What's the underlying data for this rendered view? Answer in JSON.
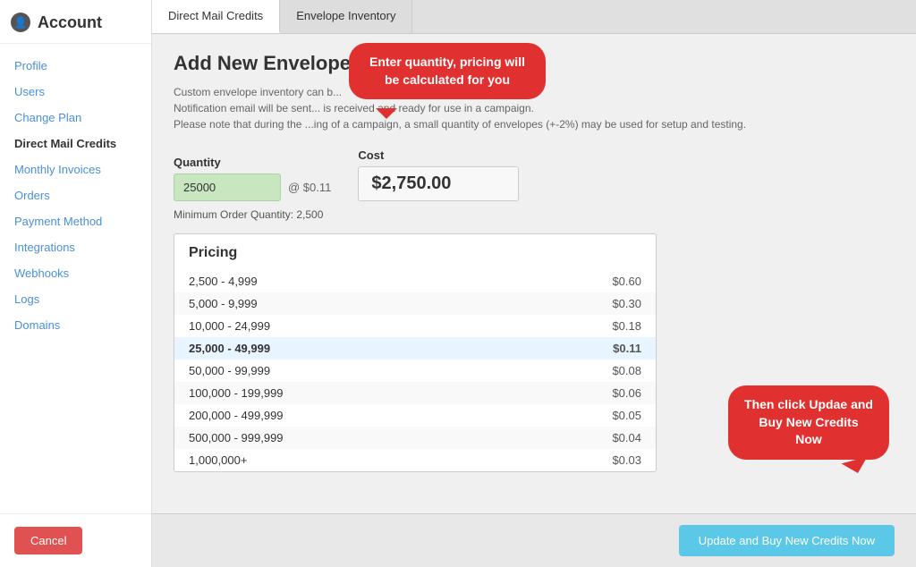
{
  "sidebar": {
    "header": {
      "icon": "👤",
      "title": "Account"
    },
    "nav_items": [
      {
        "label": "Profile",
        "href": "#",
        "active": false
      },
      {
        "label": "Users",
        "href": "#",
        "active": false
      },
      {
        "label": "Change Plan",
        "href": "#",
        "active": false
      },
      {
        "label": "Direct Mail Credits",
        "href": "#",
        "active": true
      },
      {
        "label": "Monthly Invoices",
        "href": "#",
        "active": false
      },
      {
        "label": "Orders",
        "href": "#",
        "active": false
      },
      {
        "label": "Payment Method",
        "href": "#",
        "active": false
      },
      {
        "label": "Integrations",
        "href": "#",
        "active": false
      },
      {
        "label": "Webhooks",
        "href": "#",
        "active": false
      },
      {
        "label": "Logs",
        "href": "#",
        "active": false
      },
      {
        "label": "Domains",
        "href": "#",
        "active": false
      }
    ],
    "cancel_label": "Cancel"
  },
  "tabs": [
    {
      "label": "Direct Mail Credits",
      "active": true
    },
    {
      "label": "Envelope Inventory",
      "active": false
    }
  ],
  "main": {
    "page_title": "Add New Envelope I...",
    "description_line1": "Custom envelope inventory can b...",
    "description_line2": "Notification email will be sen... is received and ready for use in a campaign.",
    "description_line3": "Please note that during the ...ing of a campaign, a small quantity of envelopes (+-2%) may be used for setup and testing.",
    "quantity_label": "Quantity",
    "quantity_value": "25000",
    "per_unit_text": "@ $0.11",
    "cost_label": "Cost",
    "cost_value": "$2,750.00",
    "min_order_text": "Minimum Order Quantity: 2,500",
    "pricing_title": "Pricing",
    "pricing_rows": [
      {
        "range": "2,500 - 4,999",
        "price": "$0.60",
        "highlighted": false
      },
      {
        "range": "5,000 - 9,999",
        "price": "$0.30",
        "highlighted": false
      },
      {
        "range": "10,000 - 24,999",
        "price": "$0.18",
        "highlighted": false
      },
      {
        "range": "25,000 - 49,999",
        "price": "$0.11",
        "highlighted": true
      },
      {
        "range": "50,000 - 99,999",
        "price": "$0.08",
        "highlighted": false
      },
      {
        "range": "100,000 - 199,999",
        "price": "$0.06",
        "highlighted": false
      },
      {
        "range": "200,000 - 499,999",
        "price": "$0.05",
        "highlighted": false
      },
      {
        "range": "500,000 - 999,999",
        "price": "$0.04",
        "highlighted": false
      },
      {
        "range": "1,000,000+",
        "price": "$0.03",
        "highlighted": false
      }
    ],
    "callout1_text": "Enter quantity, pricing will be calculated for you",
    "callout2_text": "Then click Updae and Buy New Credits Now",
    "update_btn_label": "Update and Buy New Credits Now"
  }
}
